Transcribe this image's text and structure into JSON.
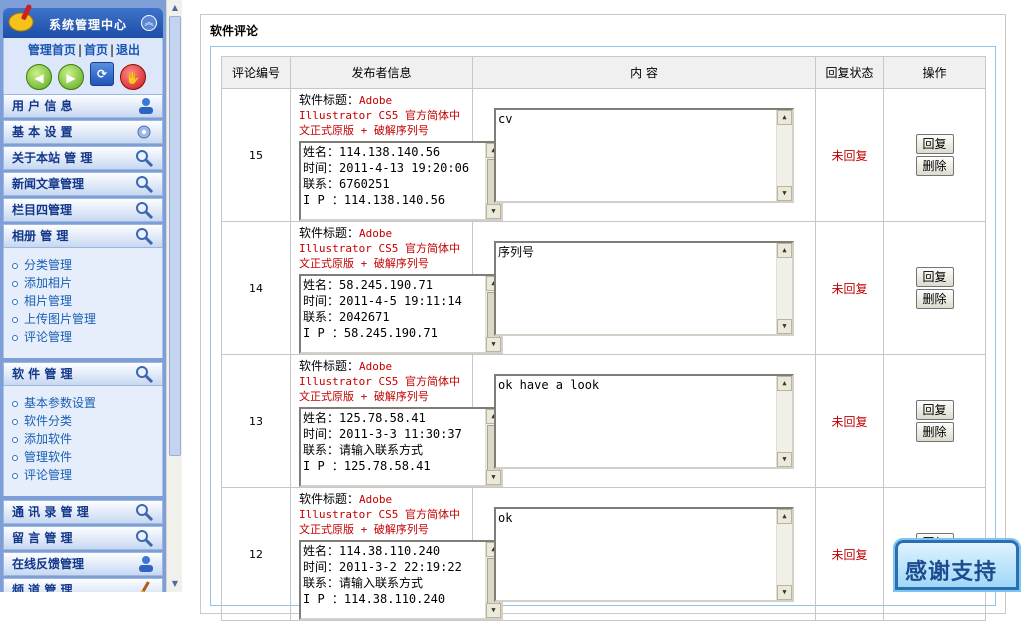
{
  "sidebar": {
    "title": "系统管理中心",
    "links": [
      "管理首页",
      "首页",
      "退出"
    ],
    "menus": [
      {
        "label": "用 户 信 息",
        "icon": "user-icon"
      },
      {
        "label": "基 本 设 置",
        "icon": "settings-icon"
      },
      {
        "label": "关于本站 管 理",
        "icon": "magnifier-icon"
      },
      {
        "label": "新闻文章管理",
        "icon": "magnifier-icon"
      },
      {
        "label": "栏目四管理",
        "icon": "magnifier-icon"
      },
      {
        "label": "相册 管 理",
        "icon": "magnifier-icon"
      },
      {
        "label": "软 件 管 理",
        "icon": "magnifier-icon"
      },
      {
        "label": "通 讯 录 管 理",
        "icon": "magnifier-icon"
      },
      {
        "label": "留 言 管 理",
        "icon": "magnifier-icon"
      },
      {
        "label": "在线反馈管理",
        "icon": "user-icon"
      },
      {
        "label": "频 道 管 理",
        "icon": "broom-icon"
      }
    ],
    "album_sub": [
      "分类管理",
      "添加相片",
      "相片管理",
      "上传图片管理",
      "评论管理"
    ],
    "software_sub": [
      "基本参数设置",
      "软件分类",
      "添加软件",
      "管理软件",
      "评论管理"
    ]
  },
  "page": {
    "section_title": "软件评论",
    "columns": [
      "评论编号",
      "发布者信息",
      "内 容",
      "回复状态",
      "操作"
    ],
    "software_title_label": "软件标题：",
    "reply_button": "回复",
    "delete_button": "删除"
  },
  "comments": [
    {
      "id": "15",
      "software": "Adobe Illustrator CS5 官方简体中文正式原版 + 破解序列号",
      "info": "姓名：114.138.140.56\n时间：2011-4-13 19:20:06\n联系：6760251\nI P ：114.138.140.56",
      "content": "cv",
      "status": "未回复"
    },
    {
      "id": "14",
      "software": "Adobe Illustrator CS5 官方简体中文正式原版 + 破解序列号",
      "info": "姓名：58.245.190.71\n时间：2011-4-5 19:11:14\n联系：2042671\nI P ：58.245.190.71",
      "content": "序列号",
      "status": "未回复"
    },
    {
      "id": "13",
      "software": "Adobe Illustrator CS5 官方简体中文正式原版 + 破解序列号",
      "info": "姓名：125.78.58.41\n时间：2011-3-3 11:30:37\n联系：请输入联系方式\nI P ：125.78.58.41",
      "content": "ok have a look",
      "status": "未回复"
    },
    {
      "id": "12",
      "software": "Adobe Illustrator CS5 官方简体中文正式原版 + 破解序列号",
      "info": "姓名：114.38.110.240\n时间：2011-3-2 22:19:22\n联系：请输入联系方式\nI P ：114.38.110.240",
      "content": "ok",
      "status": "未回复"
    }
  ],
  "badge": {
    "text": "感谢支持"
  }
}
